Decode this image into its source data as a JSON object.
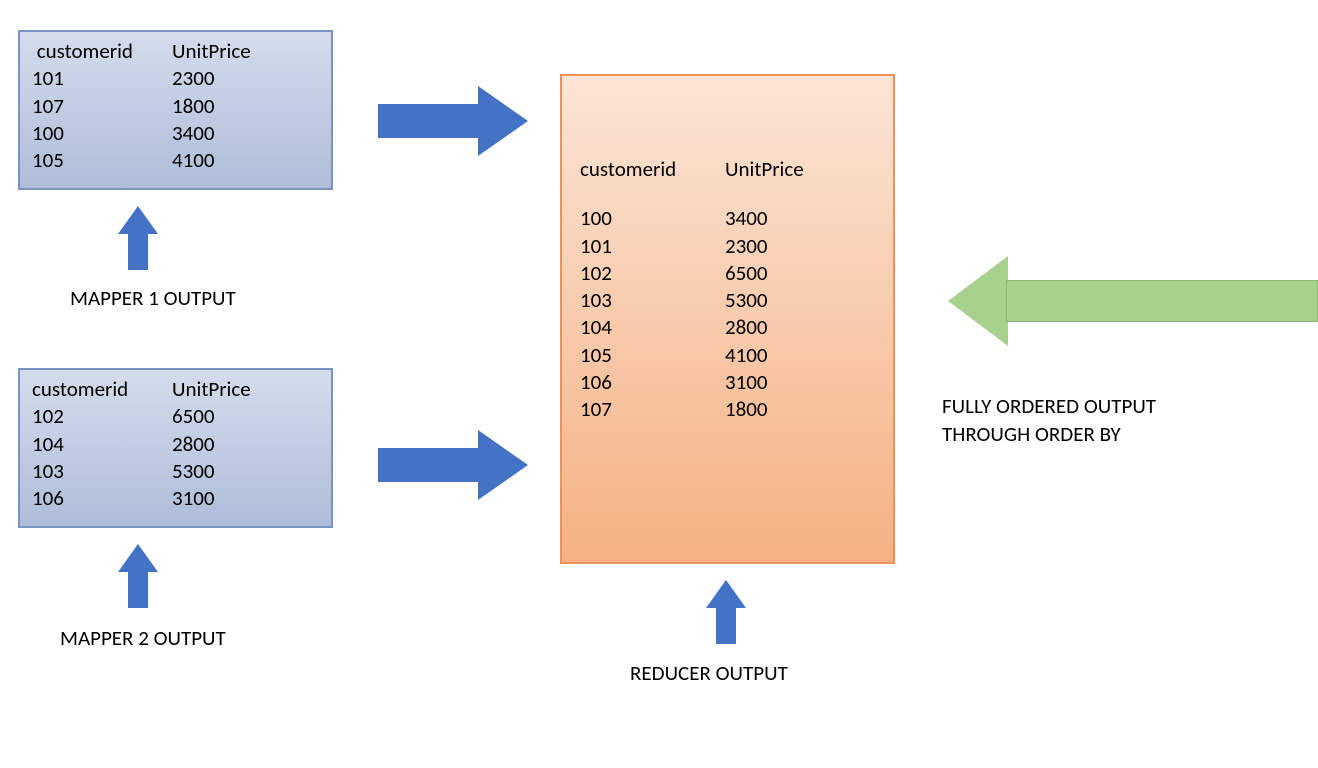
{
  "mapper1": {
    "headers": {
      "col1": "customerid",
      "col2": "UnitPrice"
    },
    "rows": [
      {
        "id": "101",
        "price": "2300"
      },
      {
        "id": "107",
        "price": "1800"
      },
      {
        "id": "100",
        "price": "3400"
      },
      {
        "id": "105",
        "price": "4100"
      }
    ],
    "label": "MAPPER 1 OUTPUT"
  },
  "mapper2": {
    "headers": {
      "col1": "customerid",
      "col2": "UnitPrice"
    },
    "rows": [
      {
        "id": "102",
        "price": "6500"
      },
      {
        "id": "104",
        "price": "2800"
      },
      {
        "id": "103",
        "price": "5300"
      },
      {
        "id": "106",
        "price": "3100"
      }
    ],
    "label": "MAPPER 2 OUTPUT"
  },
  "reducer": {
    "headers": {
      "col1": "customerid",
      "col2": "UnitPrice"
    },
    "rows": [
      {
        "id": "100",
        "price": "3400"
      },
      {
        "id": "101",
        "price": "2300"
      },
      {
        "id": "102",
        "price": "6500"
      },
      {
        "id": "103",
        "price": "5300"
      },
      {
        "id": "104",
        "price": "2800"
      },
      {
        "id": "105",
        "price": "4100"
      },
      {
        "id": "106",
        "price": "3100"
      },
      {
        "id": "107",
        "price": "1800"
      }
    ],
    "label": "REDUCER OUTPUT"
  },
  "annotation": {
    "line1": "FULLY ORDERED OUTPUT",
    "line2": "THROUGH ORDER BY"
  }
}
